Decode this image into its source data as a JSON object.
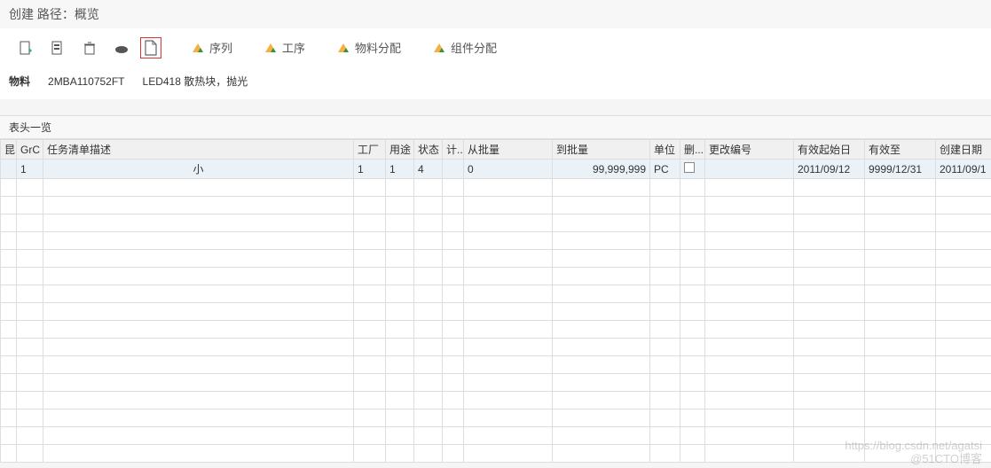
{
  "header": {
    "title": "创建 路径：概览"
  },
  "toolbar": {
    "seq": "序列",
    "process": "工序",
    "material_alloc": "物料分配",
    "component_alloc": "组件分配"
  },
  "info": {
    "material_label": "物料",
    "material_value": "2MBA110752FT",
    "material_desc": "LED418 散热块，抛光"
  },
  "grid": {
    "caption": "表头一览",
    "headers": {
      "sel": "昆",
      "grc": "GrC",
      "desc": "任务清单描述",
      "plant": "工厂",
      "usage": "用途",
      "status": "状态",
      "ji": "计...",
      "from_lot": "从批量",
      "to_lot": "到批量",
      "unit": "单位",
      "del": "删...",
      "change_no": "更改编号",
      "valid_from": "有效起始日",
      "valid_to": "有效至",
      "create_date": "创建日期"
    },
    "row": {
      "grc": "1",
      "desc": "小",
      "plant": "1",
      "usage": "1",
      "status": "4",
      "ji": "",
      "from_lot": "0",
      "to_lot": "99,999,999",
      "unit": "PC",
      "change_no": "",
      "valid_from": "2011/09/12",
      "valid_to": "9999/12/31",
      "create_date": "2011/09/1"
    }
  },
  "watermark": "https://blog.csdn.net/agatsi",
  "watermark2": "@51CTO博客"
}
